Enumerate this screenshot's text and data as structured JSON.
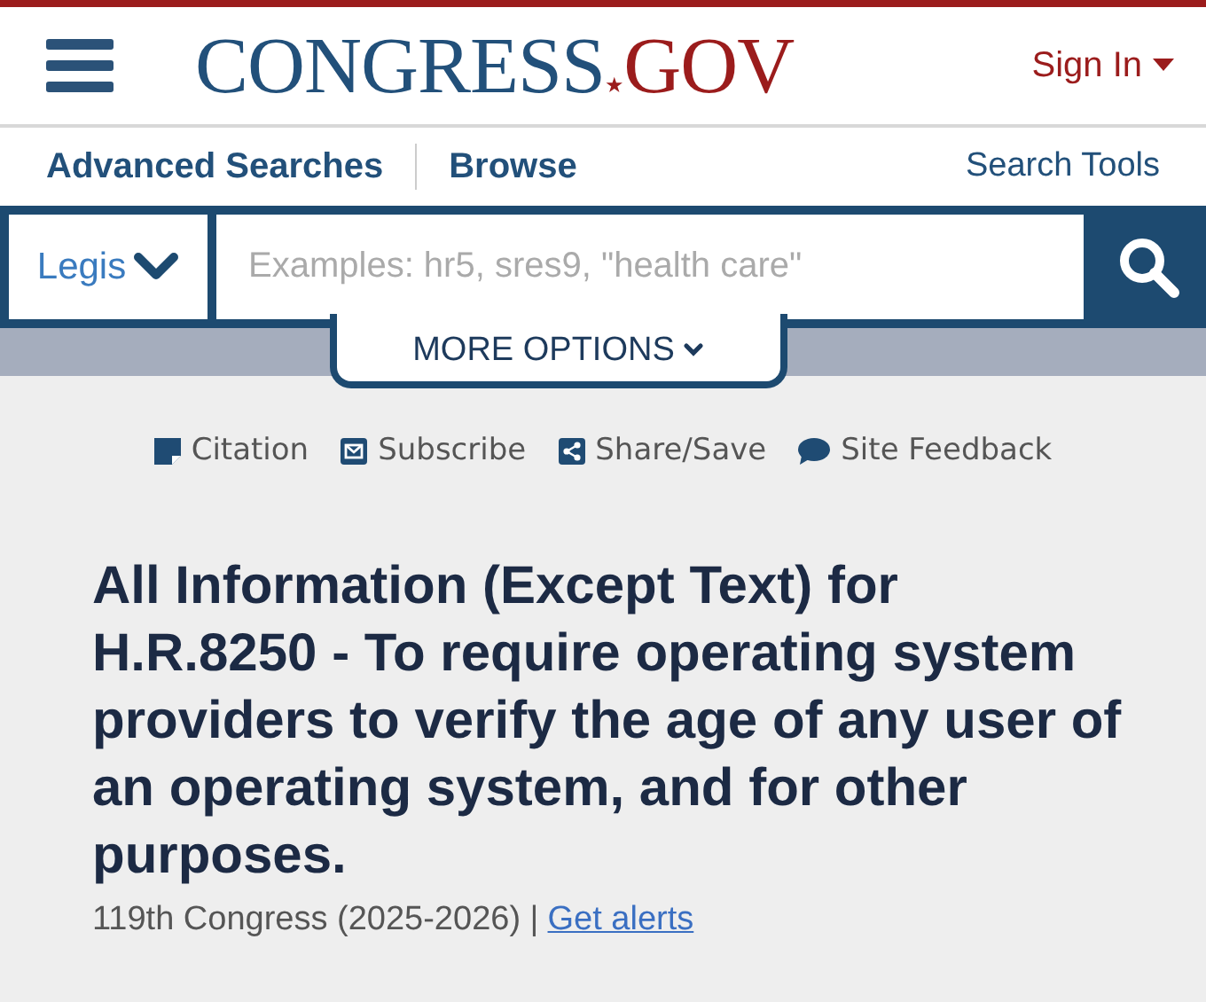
{
  "header": {
    "logo": {
      "main": "CONGRESS",
      "star": "★",
      "suffix": "GOV"
    },
    "sign_in": "Sign In"
  },
  "nav": {
    "items": [
      "Advanced Searches",
      "Browse"
    ],
    "right": "Search Tools"
  },
  "search": {
    "scope": "Legis",
    "placeholder": "Examples: hr5, sres9, \"health care\"",
    "more_options": "MORE OPTIONS"
  },
  "actions": [
    "Citation",
    "Subscribe",
    "Share/Save",
    "Site Feedback"
  ],
  "bill": {
    "title": "All Information (Except Text) for H.R.8250 - To require operating system providers to verify the age of any user of an operating system, and for other purposes.",
    "congress": "119th Congress (2025-2026) |",
    "alerts_link": "Get alerts"
  }
}
